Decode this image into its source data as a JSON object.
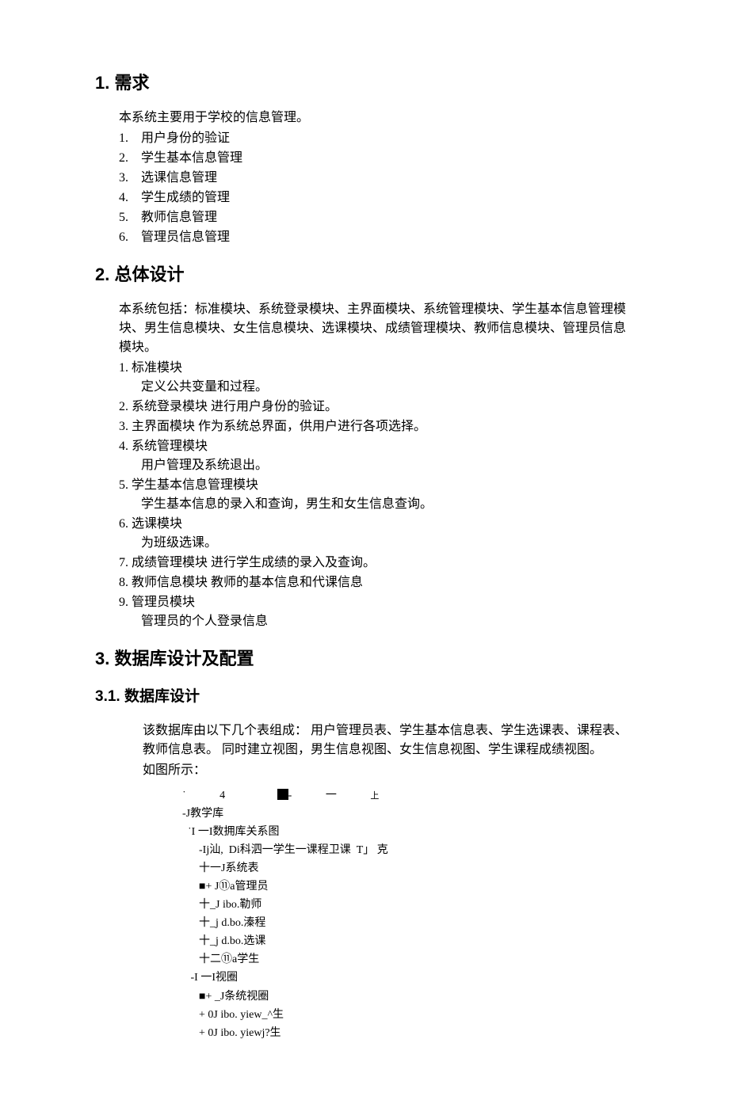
{
  "sections": {
    "s1": {
      "num": "1.",
      "title": "需求",
      "intro": "本系统主要用于学校的信息管理。",
      "items": [
        {
          "num": "1.",
          "text": "用户身份的验证"
        },
        {
          "num": "2.",
          "text": "学生基本信息管理"
        },
        {
          "num": "3.",
          "text": "选课信息管理"
        },
        {
          "num": "4.",
          "text": "学生成绩的管理"
        },
        {
          "num": "5.",
          "text": "教师信息管理"
        },
        {
          "num": "6.",
          "text": "管理员信息管理"
        }
      ]
    },
    "s2": {
      "num": "2.",
      "title": "总体设计",
      "intro": "本系统包括：标准模块、系统登录模块、主界面模块、系统管理模块、学生基本信息管理模块、男生信息模块、女生信息模块、选课模块、成绩管理模块、教师信息模块、管理员信息模块。",
      "items": [
        {
          "num": "1.",
          "text": "标准模块",
          "sub": "定义公共变量和过程。"
        },
        {
          "num": "2.",
          "text": "系统登录模块  进行用户身份的验证。"
        },
        {
          "num": "3.",
          "text": "主界面模块  作为系统总界面，供用户进行各项选择。"
        },
        {
          "num": "4.",
          "text": "系统管理模块",
          "sub": "用户管理及系统退出。"
        },
        {
          "num": "5.",
          "text": "  学生基本信息管理模块",
          "sub": "学生基本信息的录入和查询，男生和女生信息查询。"
        },
        {
          "num": "6.",
          "text": "选课模块",
          "sub": "为班级选课。"
        },
        {
          "num": "7.",
          "text": "  成绩管理模块  进行学生成绩的录入及查询。"
        },
        {
          "num": "8.",
          "text": "  教师信息模块  教师的基本信息和代课信息"
        },
        {
          "num": "9.",
          "text": "管理员模块",
          "sub": "管理员的个人登录信息"
        }
      ]
    },
    "s3": {
      "num": "3.",
      "title": "数据库设计及配置",
      "sub1": {
        "num": "3.1.",
        "title": "数据库设计",
        "para1": "该数据库由以下几个表组成：    用户管理员表、学生基本信息表、学生选课表、课程表、教师信息表。  同时建立视图，男生信息视图、女生信息视图、学生课程成绩视图。",
        "para2": "如图所示：",
        "tree": {
          "l0": "-J教学库",
          "l1": "  ˙I 一I数拥库关系图",
          "l2": "      -Ij汕,  Di科泗一学生一课程卫课  T」 克",
          "l3": "      十一J系统表",
          "l4": "      ■+ J⑪a管理员",
          "l5": "      十_J ibo.勒师",
          "l6": "      十_j d.bo.溱程",
          "l7": "      十_j d.bo.选课",
          "l8": "      十二⑪a学生",
          "l9": "   -I 一I视圈",
          "l10": "      ■+ _J条统视圈",
          "l11": "      + 0J ibo. yiew_^生",
          "l12": "      + 0J ibo. yiewj?生"
        }
      }
    }
  }
}
